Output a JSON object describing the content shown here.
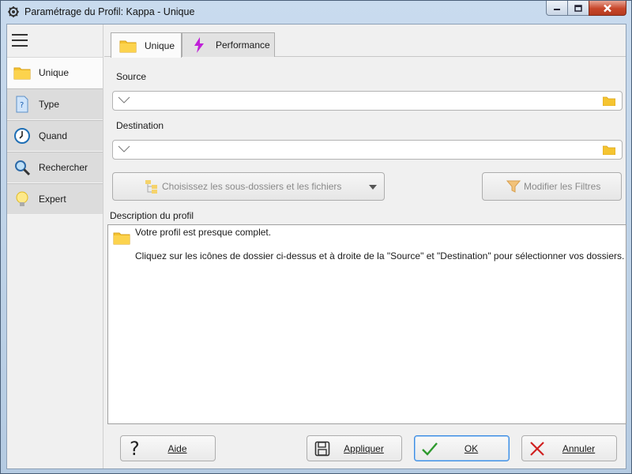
{
  "window": {
    "title": "Paramétrage du Profil: Kappa - Unique"
  },
  "sidebar": {
    "items": [
      {
        "label": "Unique",
        "icon": "folder-icon"
      },
      {
        "label": "Type",
        "icon": "document-question-icon"
      },
      {
        "label": "Quand",
        "icon": "clock-icon"
      },
      {
        "label": "Rechercher",
        "icon": "magnifier-icon"
      },
      {
        "label": "Expert",
        "icon": "lightbulb-icon"
      }
    ]
  },
  "tabs": [
    {
      "label": "Unique",
      "icon": "folder-icon"
    },
    {
      "label": "Performance",
      "icon": "lightning-icon"
    }
  ],
  "source": {
    "label": "Source",
    "value": ""
  },
  "destination": {
    "label": "Destination",
    "value": ""
  },
  "buttons": {
    "subfolders": "Choisissez les sous-dossiers et les fichiers",
    "filters": "Modifier les Filtres"
  },
  "description": {
    "label": "Description du profil",
    "line1": "Votre profil est presque complet.",
    "line2": "Cliquez sur les icônes de dossier ci-dessus et à droite de la \"Source\" et \"Destination\" pour sélectionner vos dossiers."
  },
  "footer": {
    "help": "Aide",
    "apply": "Appliquer",
    "ok": "OK",
    "cancel": "Annuler"
  },
  "colors": {
    "folder": "#f5c431",
    "lightning": "#c020d8",
    "cancel_x": "#d02020",
    "ok_check": "#2e9a2e"
  }
}
